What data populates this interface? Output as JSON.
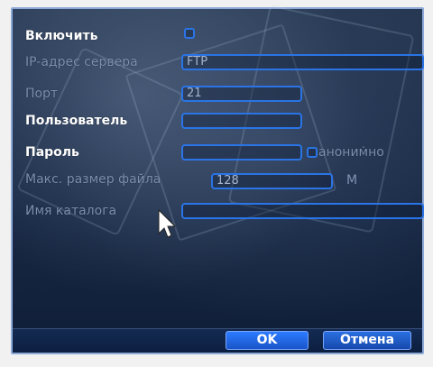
{
  "form": {
    "enable_label": "Включить",
    "server_ip_label": "IP-адрес сервера",
    "server_ip_value": "FTP",
    "port_label": "Порт",
    "port_value": "21",
    "user_label": "Пользователь",
    "user_value": "",
    "password_label": "Пароль",
    "password_value": "",
    "anonymous_label": "аноним̇но",
    "max_file_size_label": "Макс. размер файла",
    "max_file_size_value": "128",
    "max_file_size_unit": "М",
    "folder_name_label": "Имя каталога",
    "folder_name_value": ""
  },
  "buttons": {
    "ok_label": "OK",
    "cancel_label": "Отмена"
  },
  "colors": {
    "accent": "#2a74e6",
    "frame": "#8da9d8"
  }
}
